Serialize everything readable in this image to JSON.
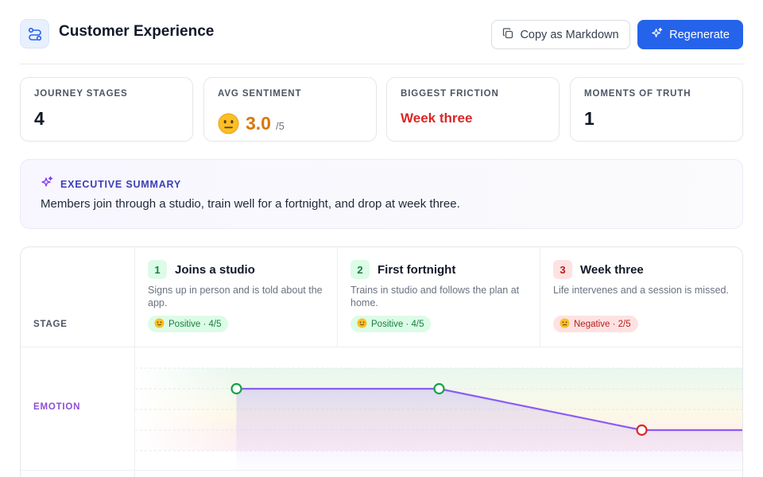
{
  "header": {
    "title": "Customer Experience",
    "app_icon": "route-icon",
    "copy_label": "Copy as Markdown",
    "copy_icon": "copy-icon",
    "regenerate_label": "Regenerate",
    "regenerate_icon": "sparkles-icon"
  },
  "stats": [
    {
      "label": "JOURNEY STAGES",
      "value": "4"
    },
    {
      "label": "AVG SENTIMENT",
      "value": "3.0",
      "suffix": "/5",
      "icon": "neutral-face-icon",
      "color": "#d97706"
    },
    {
      "label": "BIGGEST FRICTION",
      "value": "Week three",
      "color": "#dc2626"
    },
    {
      "label": "MOMENTS OF TRUTH",
      "value": "1"
    }
  ],
  "summary": {
    "title": "EXECUTIVE SUMMARY",
    "icon": "sparkles-icon",
    "text": "Members join through a studio, train well for a fortnight, and drop at week three."
  },
  "journey": {
    "stage_row_label": "STAGE",
    "emotion_row_label": "EMOTION",
    "stages": [
      {
        "num": "1",
        "name": "Joins a studio",
        "desc": "Signs up in person and is told about the app.",
        "sentiment": "Positive · 4/5",
        "tone": "positive",
        "score": 4
      },
      {
        "num": "2",
        "name": "First fortnight",
        "desc": "Trains in studio and follows the plan at home.",
        "sentiment": "Positive · 4/5",
        "tone": "positive",
        "score": 4
      },
      {
        "num": "3",
        "name": "Week three",
        "desc": "Life intervenes and a session is missed.",
        "sentiment": "Negative · 2/5",
        "tone": "negative",
        "score": 2
      }
    ]
  },
  "colors": {
    "accent": "#2563eb",
    "emotion_line": "#8b5cf6",
    "positive": "#16a34a",
    "negative": "#dc2626",
    "warning": "#d97706"
  }
}
